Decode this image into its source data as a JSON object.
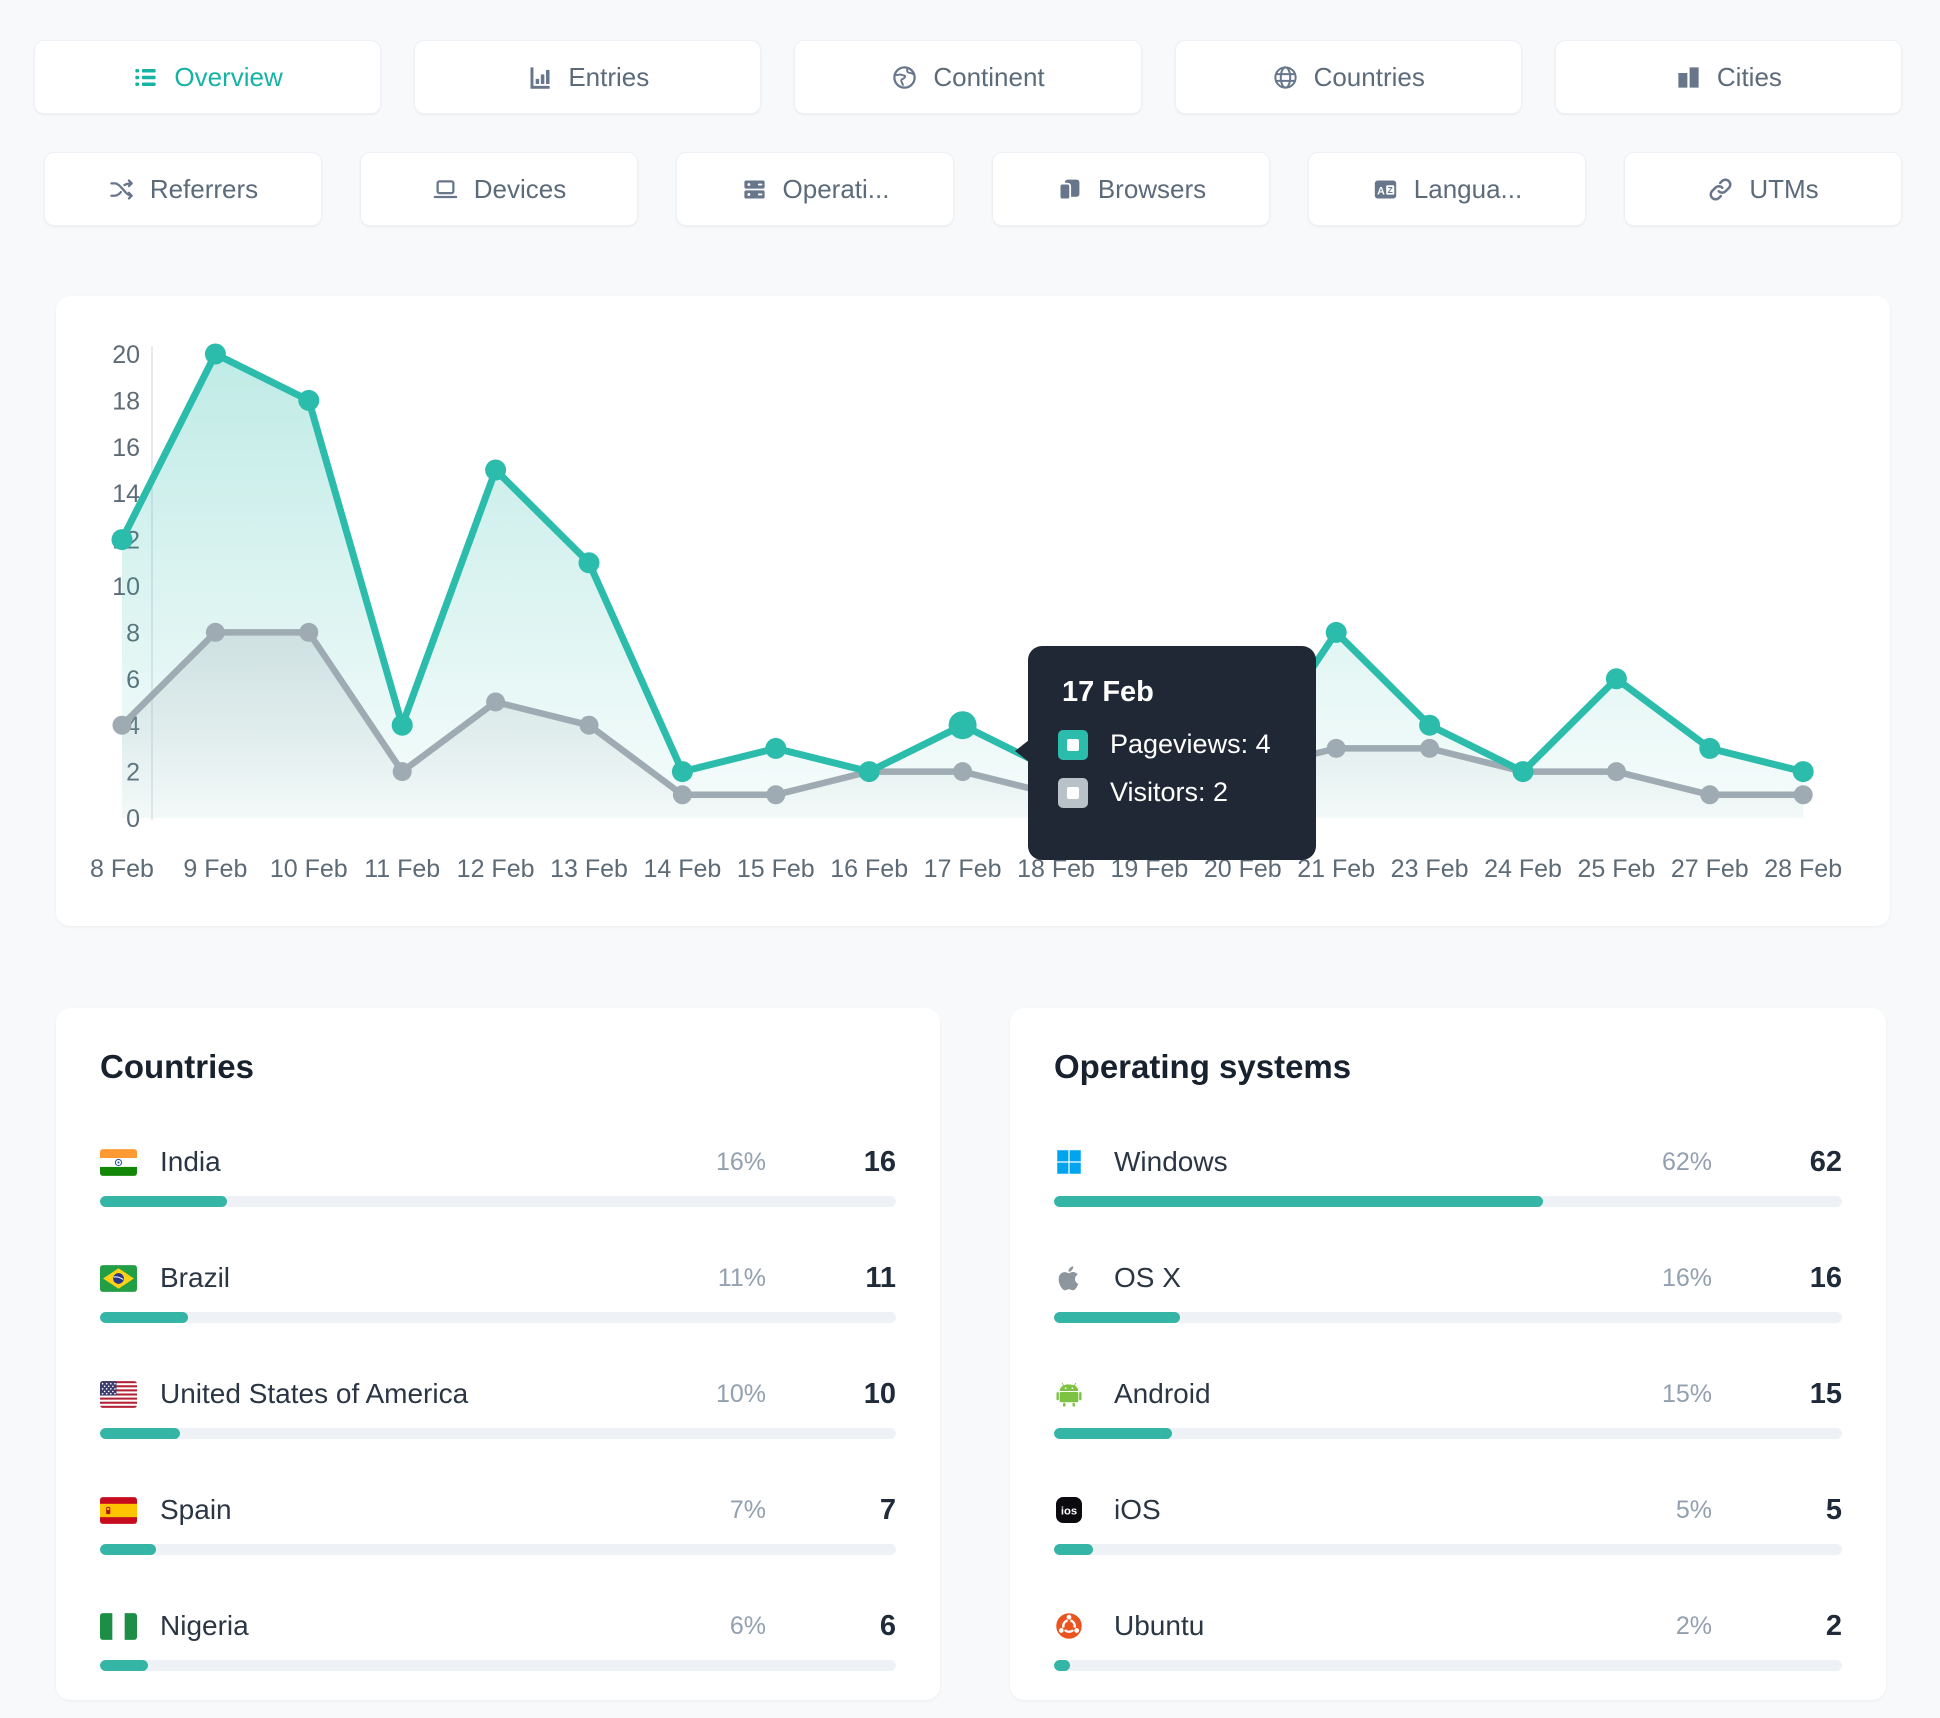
{
  "colors": {
    "accent": "#2cbcab",
    "accent_bar": "#35b5a5",
    "gray_series": "#9fabb2",
    "tooltip_bg": "#202835"
  },
  "tabs": {
    "row1": [
      {
        "label": "Overview",
        "icon": "list",
        "active": true
      },
      {
        "label": "Entries",
        "icon": "entries-chart",
        "active": false
      },
      {
        "label": "Continent",
        "icon": "continent-globe",
        "active": false
      },
      {
        "label": "Countries",
        "icon": "countries-globe",
        "active": false
      },
      {
        "label": "Cities",
        "icon": "cities-buildings",
        "active": false
      }
    ],
    "row2": [
      {
        "label": "Referrers",
        "icon": "shuffle",
        "active": false
      },
      {
        "label": "Devices",
        "icon": "laptop",
        "active": false
      },
      {
        "label": "Operati...",
        "icon": "server",
        "active": false
      },
      {
        "label": "Browsers",
        "icon": "browser-window",
        "active": false
      },
      {
        "label": "Langua...",
        "icon": "translate",
        "active": false
      },
      {
        "label": "UTMs",
        "icon": "link",
        "active": false
      }
    ]
  },
  "chart_data": {
    "type": "line",
    "x": [
      "8 Feb",
      "9 Feb",
      "10 Feb",
      "11 Feb",
      "12 Feb",
      "13 Feb",
      "14 Feb",
      "15 Feb",
      "16 Feb",
      "17 Feb",
      "18 Feb",
      "19 Feb",
      "20 Feb",
      "21 Feb",
      "23 Feb",
      "24 Feb",
      "25 Feb",
      "27 Feb",
      "28 Feb"
    ],
    "series": [
      {
        "name": "Pageviews",
        "color": "#2cbcab",
        "values": [
          12,
          20,
          18,
          4,
          15,
          11,
          2,
          3,
          2,
          4,
          2,
          1,
          2,
          8,
          4,
          2,
          6,
          3,
          2
        ]
      },
      {
        "name": "Visitors",
        "color": "#9fabb2",
        "values": [
          4,
          8,
          8,
          2,
          5,
          4,
          1,
          1,
          2,
          2,
          1,
          1,
          2,
          3,
          3,
          2,
          2,
          1,
          1
        ]
      }
    ],
    "ylim": [
      0,
      20
    ],
    "ytick_step": 2,
    "grid": "none",
    "legend": "none",
    "highlight_index": 9
  },
  "tooltip": {
    "date": "17 Feb",
    "rows": [
      {
        "text": "Pageviews: 4",
        "color": "#2cbcab"
      },
      {
        "text": "Visitors: 2",
        "color": "#b9c1c9"
      }
    ]
  },
  "countries": {
    "title": "Countries",
    "rows": [
      {
        "name": "India",
        "flag": "india",
        "pct_label": "16%",
        "count": "16",
        "pct": 16
      },
      {
        "name": "Brazil",
        "flag": "brazil",
        "pct_label": "11%",
        "count": "11",
        "pct": 11
      },
      {
        "name": "United States of America",
        "flag": "usa",
        "pct_label": "10%",
        "count": "10",
        "pct": 10
      },
      {
        "name": "Spain",
        "flag": "spain",
        "pct_label": "7%",
        "count": "7",
        "pct": 7
      },
      {
        "name": "Nigeria",
        "flag": "nigeria",
        "pct_label": "6%",
        "count": "6",
        "pct": 6
      }
    ]
  },
  "operating_systems": {
    "title": "Operating systems",
    "rows": [
      {
        "name": "Windows",
        "icon": "windows",
        "pct_label": "62%",
        "count": "62",
        "pct": 62
      },
      {
        "name": "OS X",
        "icon": "apple",
        "pct_label": "16%",
        "count": "16",
        "pct": 16
      },
      {
        "name": "Android",
        "icon": "android",
        "pct_label": "15%",
        "count": "15",
        "pct": 15
      },
      {
        "name": "iOS",
        "icon": "ios",
        "pct_label": "5%",
        "count": "5",
        "pct": 5
      },
      {
        "name": "Ubuntu",
        "icon": "ubuntu",
        "pct_label": "2%",
        "count": "2",
        "pct": 2
      }
    ]
  }
}
